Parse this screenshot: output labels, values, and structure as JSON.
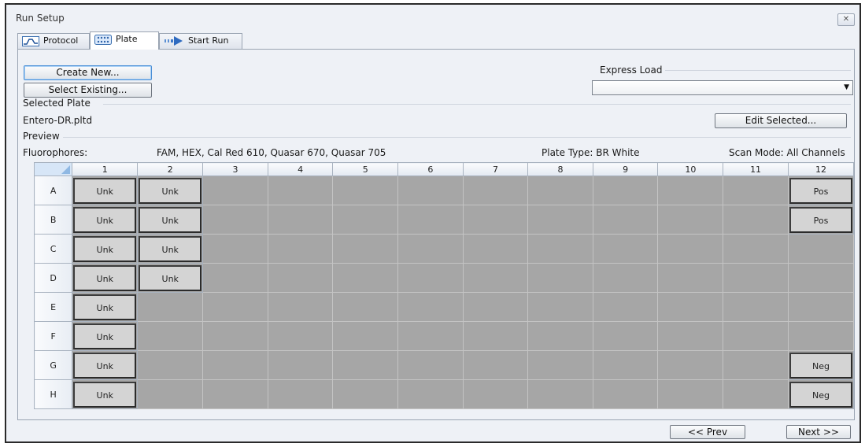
{
  "window": {
    "title": "Run Setup",
    "close_glyph": "✕"
  },
  "tabs": [
    {
      "label": "Protocol",
      "icon": "protocol-curve-icon",
      "active": false
    },
    {
      "label": "Plate",
      "icon": "plate-grid-icon",
      "active": true
    },
    {
      "label": "Start Run",
      "icon": "start-run-arrow-icon",
      "active": false
    }
  ],
  "plate_setup": {
    "create_new_label": "Create New...",
    "select_existing_label": "Select Existing...",
    "express_load_label": "Express Load",
    "express_load_value": "",
    "selected_plate_label": "Selected Plate",
    "selected_plate_file": "Entero-DR.pltd",
    "edit_selected_label": "Edit Selected..."
  },
  "preview": {
    "label": "Preview",
    "fluorophores_label": "Fluorophores:",
    "fluorophores_value": "FAM, HEX, Cal Red 610, Quasar 670, Quasar 705",
    "plate_type": "Plate Type: BR White",
    "scan_mode": "Scan Mode: All Channels"
  },
  "plate": {
    "columns": [
      "1",
      "2",
      "3",
      "4",
      "5",
      "6",
      "7",
      "8",
      "9",
      "10",
      "11",
      "12"
    ],
    "rows": [
      "A",
      "B",
      "C",
      "D",
      "E",
      "F",
      "G",
      "H"
    ],
    "wells": [
      [
        "Unk",
        "Unk",
        "",
        "",
        "",
        "",
        "",
        "",
        "",
        "",
        "",
        "Pos"
      ],
      [
        "Unk",
        "Unk",
        "",
        "",
        "",
        "",
        "",
        "",
        "",
        "",
        "",
        "Pos"
      ],
      [
        "Unk",
        "Unk",
        "",
        "",
        "",
        "",
        "",
        "",
        "",
        "",
        "",
        ""
      ],
      [
        "Unk",
        "Unk",
        "",
        "",
        "",
        "",
        "",
        "",
        "",
        "",
        "",
        ""
      ],
      [
        "Unk",
        "",
        "",
        "",
        "",
        "",
        "",
        "",
        "",
        "",
        "",
        ""
      ],
      [
        "Unk",
        "",
        "",
        "",
        "",
        "",
        "",
        "",
        "",
        "",
        "",
        ""
      ],
      [
        "Unk",
        "",
        "",
        "",
        "",
        "",
        "",
        "",
        "",
        "",
        "",
        "Neg"
      ],
      [
        "Unk",
        "",
        "",
        "",
        "",
        "",
        "",
        "",
        "",
        "",
        "",
        "Neg"
      ]
    ]
  },
  "navigation": {
    "prev_label": "<< Prev",
    "next_label": "Next >>"
  },
  "colors": {
    "window_bg": "#eef1f6",
    "empty_well": "#a6a6a6",
    "filled_well": "#d4d4d4",
    "header_bg": "#e3e9f1",
    "focus_border": "#4a8fd6"
  }
}
